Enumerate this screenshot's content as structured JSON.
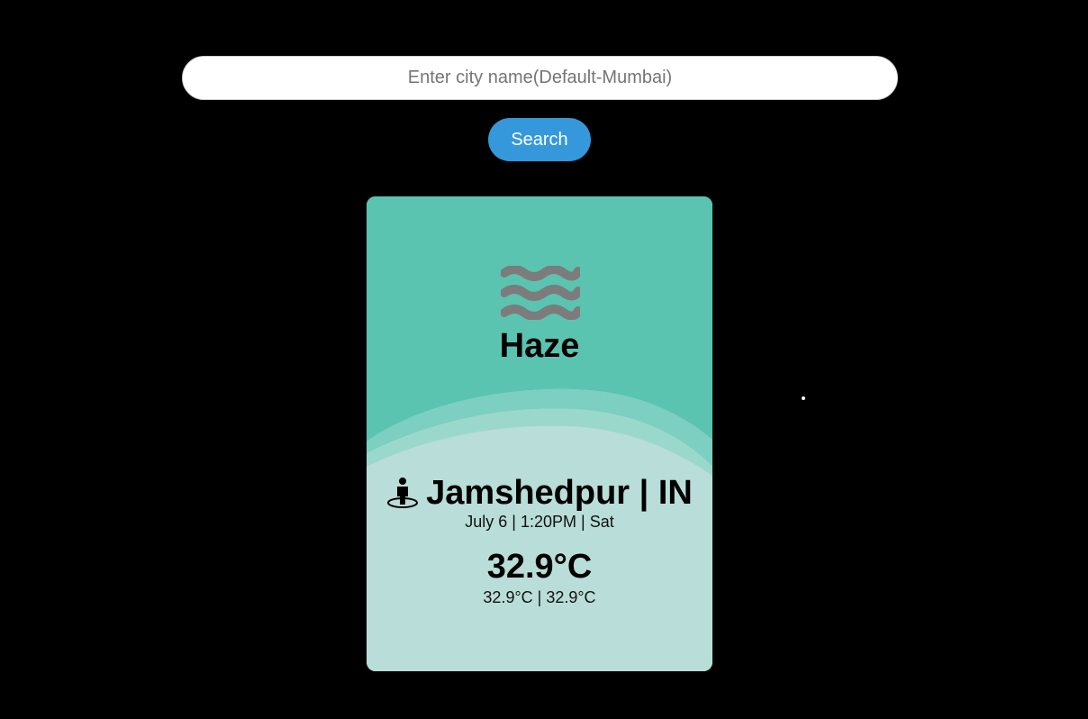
{
  "search": {
    "placeholder": "Enter city name(Default-Mumbai)",
    "value": "",
    "button_label": "Search"
  },
  "weather": {
    "condition": "Haze",
    "icon": "haze-waves-icon",
    "location": "Jamshedpur | IN",
    "location_icon": "street-view-icon",
    "datetime": "July 6 | 1:20PM | Sat",
    "temperature": "32.9°C",
    "min_max": "32.9°C | 32.9°C"
  },
  "colors": {
    "background": "#000000",
    "button": "#3498db",
    "card_top": "#5bc4b0",
    "card_bottom": "#b9ddd8",
    "icon": "#7c7c7c"
  }
}
